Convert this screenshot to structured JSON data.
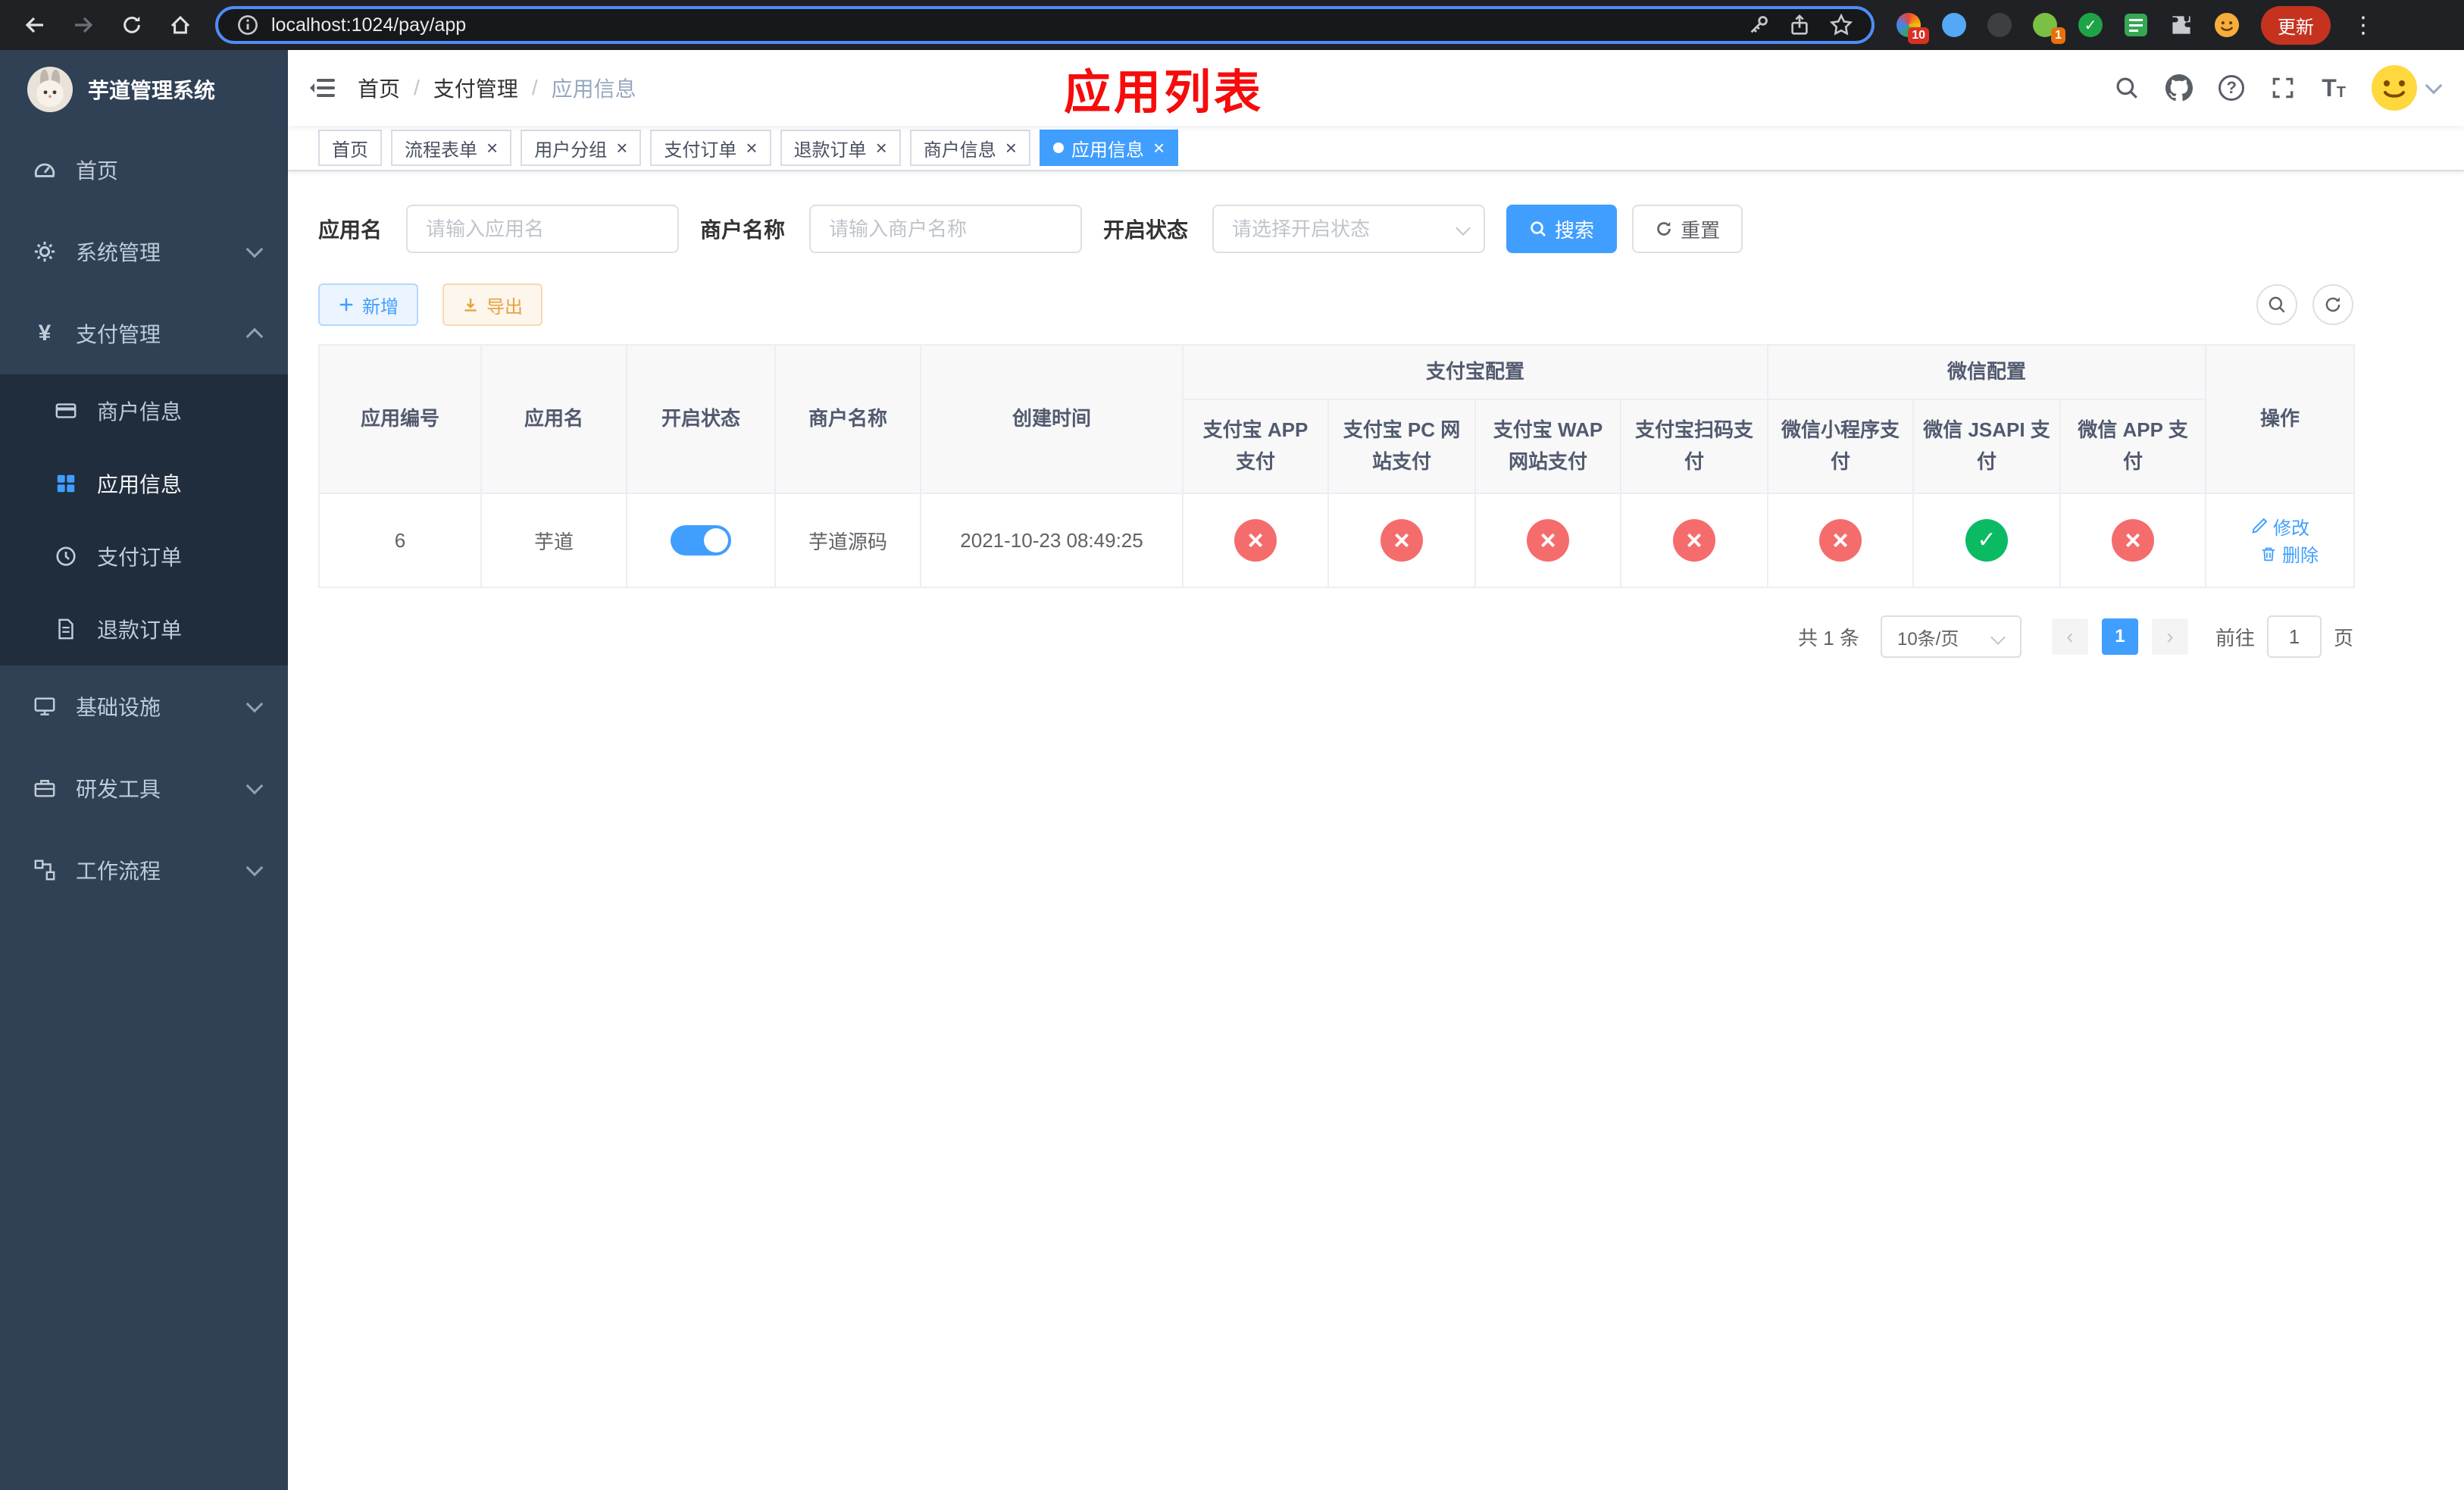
{
  "colors": {
    "primary": "#409eff",
    "annotation": "#f70b0b",
    "status_off": "#f56c6c",
    "status_on": "#0abb64",
    "sidebar_bg": "#304156",
    "submenu_bg": "#1f2d3d",
    "export_accent": "#e6a23c"
  },
  "icons": {
    "close": "×",
    "more": "⋮",
    "prev": "‹",
    "next": "›",
    "question": "?",
    "yen": "¥",
    "fontsize": "T",
    "fontsize_small": "T",
    "breadcrumb_sep": "/"
  },
  "browser": {
    "url": "localhost:1024/pay/app",
    "update_label": "更新",
    "badges": {
      "ext1": "10",
      "ext2": "1"
    }
  },
  "sidebar": {
    "title": "芋道管理系统",
    "items": {
      "home": "首页",
      "system": "系统管理",
      "pay": "支付管理",
      "merchant": "商户信息",
      "app": "应用信息",
      "pay_order": "支付订单",
      "refund_order": "退款订单",
      "infra": "基础设施",
      "dev_tools": "研发工具",
      "workflow": "工作流程"
    }
  },
  "header": {
    "breadcrumb": [
      "首页",
      "支付管理",
      "应用信息"
    ],
    "annotation": "应用列表"
  },
  "tabs": [
    {
      "label": "首页",
      "closable": false,
      "active": false
    },
    {
      "label": "流程表单",
      "closable": true,
      "active": false
    },
    {
      "label": "用户分组",
      "closable": true,
      "active": false
    },
    {
      "label": "支付订单",
      "closable": true,
      "active": false
    },
    {
      "label": "退款订单",
      "closable": true,
      "active": false
    },
    {
      "label": "商户信息",
      "closable": true,
      "active": false
    },
    {
      "label": "应用信息",
      "closable": true,
      "active": true
    }
  ],
  "filters": {
    "app_name_label": "应用名",
    "app_name_placeholder": "请输入应用名",
    "merchant_label": "商户名称",
    "merchant_placeholder": "请输入商户名称",
    "status_label": "开启状态",
    "status_placeholder": "请选择开启状态",
    "search_label": "搜索",
    "reset_label": "重置"
  },
  "toolbar": {
    "add_label": "新增",
    "export_label": "导出"
  },
  "table": {
    "headers": {
      "app_id": "应用编号",
      "app_name": "应用名",
      "status": "开启状态",
      "merchant_name": "商户名称",
      "create_time": "创建时间",
      "alipay_group": "支付宝配置",
      "wechat_group": "微信配置",
      "alipay_app": "支付宝 APP 支付",
      "alipay_pc": "支付宝 PC 网站支付",
      "alipay_wap": "支付宝 WAP 网站支付",
      "alipay_qr": "支付宝扫码支付",
      "wx_lite": "微信小程序支付",
      "wx_jsapi": "微信 JSAPI 支付",
      "wx_app": "微信 APP 支付",
      "actions": "操作"
    },
    "rows": [
      {
        "app_id": "6",
        "app_name": "芋道",
        "status_on": true,
        "merchant_name": "芋道源码",
        "create_time": "2021-10-23 08:49:25",
        "alipay_app": false,
        "alipay_pc": false,
        "alipay_wap": false,
        "alipay_qr": false,
        "wx_lite": false,
        "wx_jsapi": true,
        "wx_app": false,
        "edit_label": "修改",
        "delete_label": "删除"
      }
    ]
  },
  "pagination": {
    "total_text": "共 1 条",
    "page_size": "10条/页",
    "current_page": "1",
    "goto_label": "前往",
    "goto_value": "1",
    "page_unit": "页"
  }
}
